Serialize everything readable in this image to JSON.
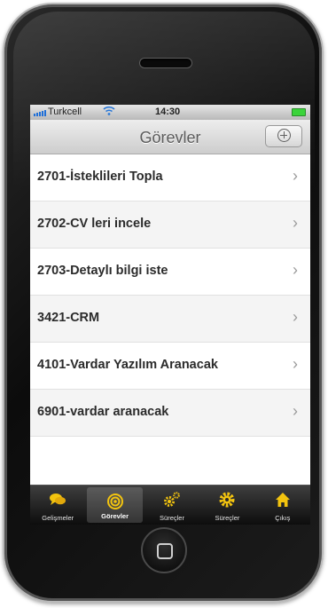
{
  "status": {
    "carrier": "Turkcell",
    "time": "14:30"
  },
  "navbar": {
    "title": "Görevler"
  },
  "tasks": [
    {
      "label": "2701-İsteklileri Topla"
    },
    {
      "label": "2702-CV leri incele"
    },
    {
      "label": "2703-Detaylı bilgi iste"
    },
    {
      "label": "3421-CRM"
    },
    {
      "label": "4101-Vardar Yazılım Aranacak"
    },
    {
      "label": "6901-vardar aranacak"
    }
  ],
  "tabs": [
    {
      "label": "Gelişmeler",
      "icon": "speech-bubbles-icon"
    },
    {
      "label": "Görevler",
      "icon": "target-icon",
      "active": true
    },
    {
      "label": "Süreçler",
      "icon": "gears-icon"
    },
    {
      "label": "Süreçler",
      "icon": "gear-icon"
    },
    {
      "label": "Çıkış",
      "icon": "home-icon"
    }
  ],
  "colors": {
    "icon_yellow": "#f3c40f",
    "tabbar_dark": "#1a1a1a",
    "signal_blue": "#1f6fd8",
    "battery_green": "#3bd43b"
  }
}
